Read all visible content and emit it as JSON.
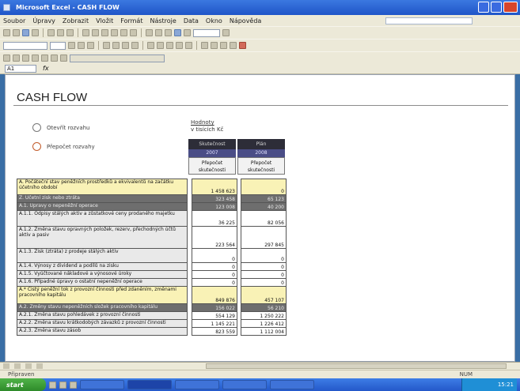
{
  "window": {
    "title": "Microsoft Excel - CASH FLOW",
    "menu": [
      "Soubor",
      "Úpravy",
      "Zobrazit",
      "Vložit",
      "Formát",
      "Nástroje",
      "Data",
      "Okno",
      "Nápověda"
    ]
  },
  "namebox": "A1",
  "sheet": {
    "title": "CASH FLOW",
    "radio_options": [
      "Otevřít rozvahu",
      "Přepočet rozvahy"
    ],
    "unit_label": "Hodnoty",
    "unit_value": "v tisících Kč",
    "columns": [
      {
        "period": "Skutečnost",
        "year": "2007",
        "subhead": "Přepočet skutečnosti"
      },
      {
        "period": "Plán",
        "year": "2008",
        "subhead": "Přepočet skutečnosti"
      }
    ],
    "rows": [
      {
        "style": "yellow",
        "label": "A. Počáteční stav peněžních prostředků a ekvivalentů na začátku účetního období",
        "v1": "1 458 623",
        "v2": "0"
      },
      {
        "style": "dark",
        "label": "Z. Účetní zisk nebo ztráta",
        "v1": "323 458",
        "v2": "65 123"
      },
      {
        "style": "dark",
        "label": "A.1. Úpravy o nepeněžní operace",
        "v1": "123 008",
        "v2": "40 200"
      },
      {
        "style": "norm",
        "label": "A.1.1. Odpisy stálých aktiv a zůstatkové ceny prodaného majetku",
        "v1": "36 225",
        "v2": "82 056"
      },
      {
        "style": "norm",
        "label": "A.1.2. Změna stavu opravných položek, rezerv, přechodných účtů aktiv a pasiv",
        "v1": "223 564",
        "v2": "297 845"
      },
      {
        "style": "norm",
        "label": "A.1.3. Zisk (ztráta) z prodeje stálých aktiv",
        "v1": "0",
        "v2": "0"
      },
      {
        "style": "norm",
        "label": "A.1.4. Výnosy z dividend a podílů na zisku",
        "v1": "0",
        "v2": "0"
      },
      {
        "style": "norm",
        "label": "A.1.5. Vyúčtované nákladové a výnosové úroky",
        "v1": "0",
        "v2": "0"
      },
      {
        "style": "norm",
        "label": "A.1.6. Případné úpravy o ostatní nepeněžní operace",
        "v1": "0",
        "v2": "0"
      },
      {
        "style": "yellow",
        "label": "A.* Čistý peněžní tok z provozní činnosti před zdaněním, změnami pracovního kapitálu",
        "v1": "849 876",
        "v2": "457 107"
      },
      {
        "style": "dark",
        "label": "A.2. Změny stavu nepeněžních složek pracovního kapitálu",
        "v1": "156 022",
        "v2": "56 210"
      },
      {
        "style": "norm",
        "label": "A.2.1. Změna stavu pohledávek z provozní činnosti",
        "v1": "554 129",
        "v2": "1 250 222"
      },
      {
        "style": "norm",
        "label": "A.2.2. Změna stavu krátkodobých závazků z provozní činnosti",
        "v1": "1 145 221",
        "v2": "1 226 412"
      },
      {
        "style": "norm",
        "label": "A.2.3. Změna stavu zásob",
        "v1": "823 559",
        "v2": "1 112 004"
      }
    ]
  },
  "statusbar": {
    "left": "Připraven",
    "right": "NUM"
  },
  "taskbar": {
    "start": "start",
    "clock": "15:21"
  }
}
